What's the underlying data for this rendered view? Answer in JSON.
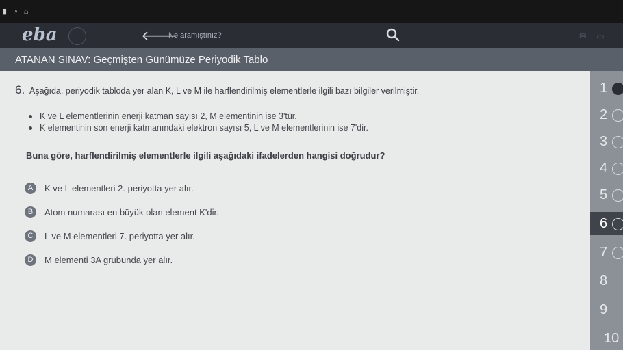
{
  "header": {
    "logo_text": "eba",
    "search_placeholder": "Ne aramıştınız?"
  },
  "exam": {
    "title": "ATANAN SINAV: Geçmişten Günümüze Periyodik Tablo"
  },
  "question": {
    "number": "6.",
    "text": "Aşağıda, periyodik tabloda yer alan K, L ve M ile harflendirilmiş elementlerle ilgili bazı bilgiler verilmiştir.",
    "bullets": [
      "K ve L elementlerinin enerji katman sayısı 2, M elementinin ise 3'tür.",
      "K elementinin son enerji katmanındaki elektron sayısı 5, L ve M elementlerinin ise 7'dir."
    ],
    "prompt": "Buna göre, harflendirilmiş elementlerle ilgili aşağıdaki ifadelerden hangisi doğrudur?",
    "options": [
      {
        "letter": "A",
        "text": "K ve L elementleri 2. periyotta yer alır."
      },
      {
        "letter": "B",
        "text": "Atom numarası en büyük olan element K'dir."
      },
      {
        "letter": "C",
        "text": "L ve M elementleri 7. periyotta yer alır."
      },
      {
        "letter": "D",
        "text": "M elementi 3A grubunda yer alır."
      }
    ]
  },
  "sidebar": {
    "items": [
      "1",
      "2",
      "3",
      "4",
      "5",
      "6",
      "7",
      "8",
      "9",
      "10"
    ],
    "active": "6"
  },
  "colors": {
    "content_bg": "#e9eaea",
    "titlebar_bg": "#5a6069",
    "topbar_bg": "#2a2d33",
    "sidebar_bg": "#8c9198",
    "active_item_bg": "#3f444b"
  }
}
